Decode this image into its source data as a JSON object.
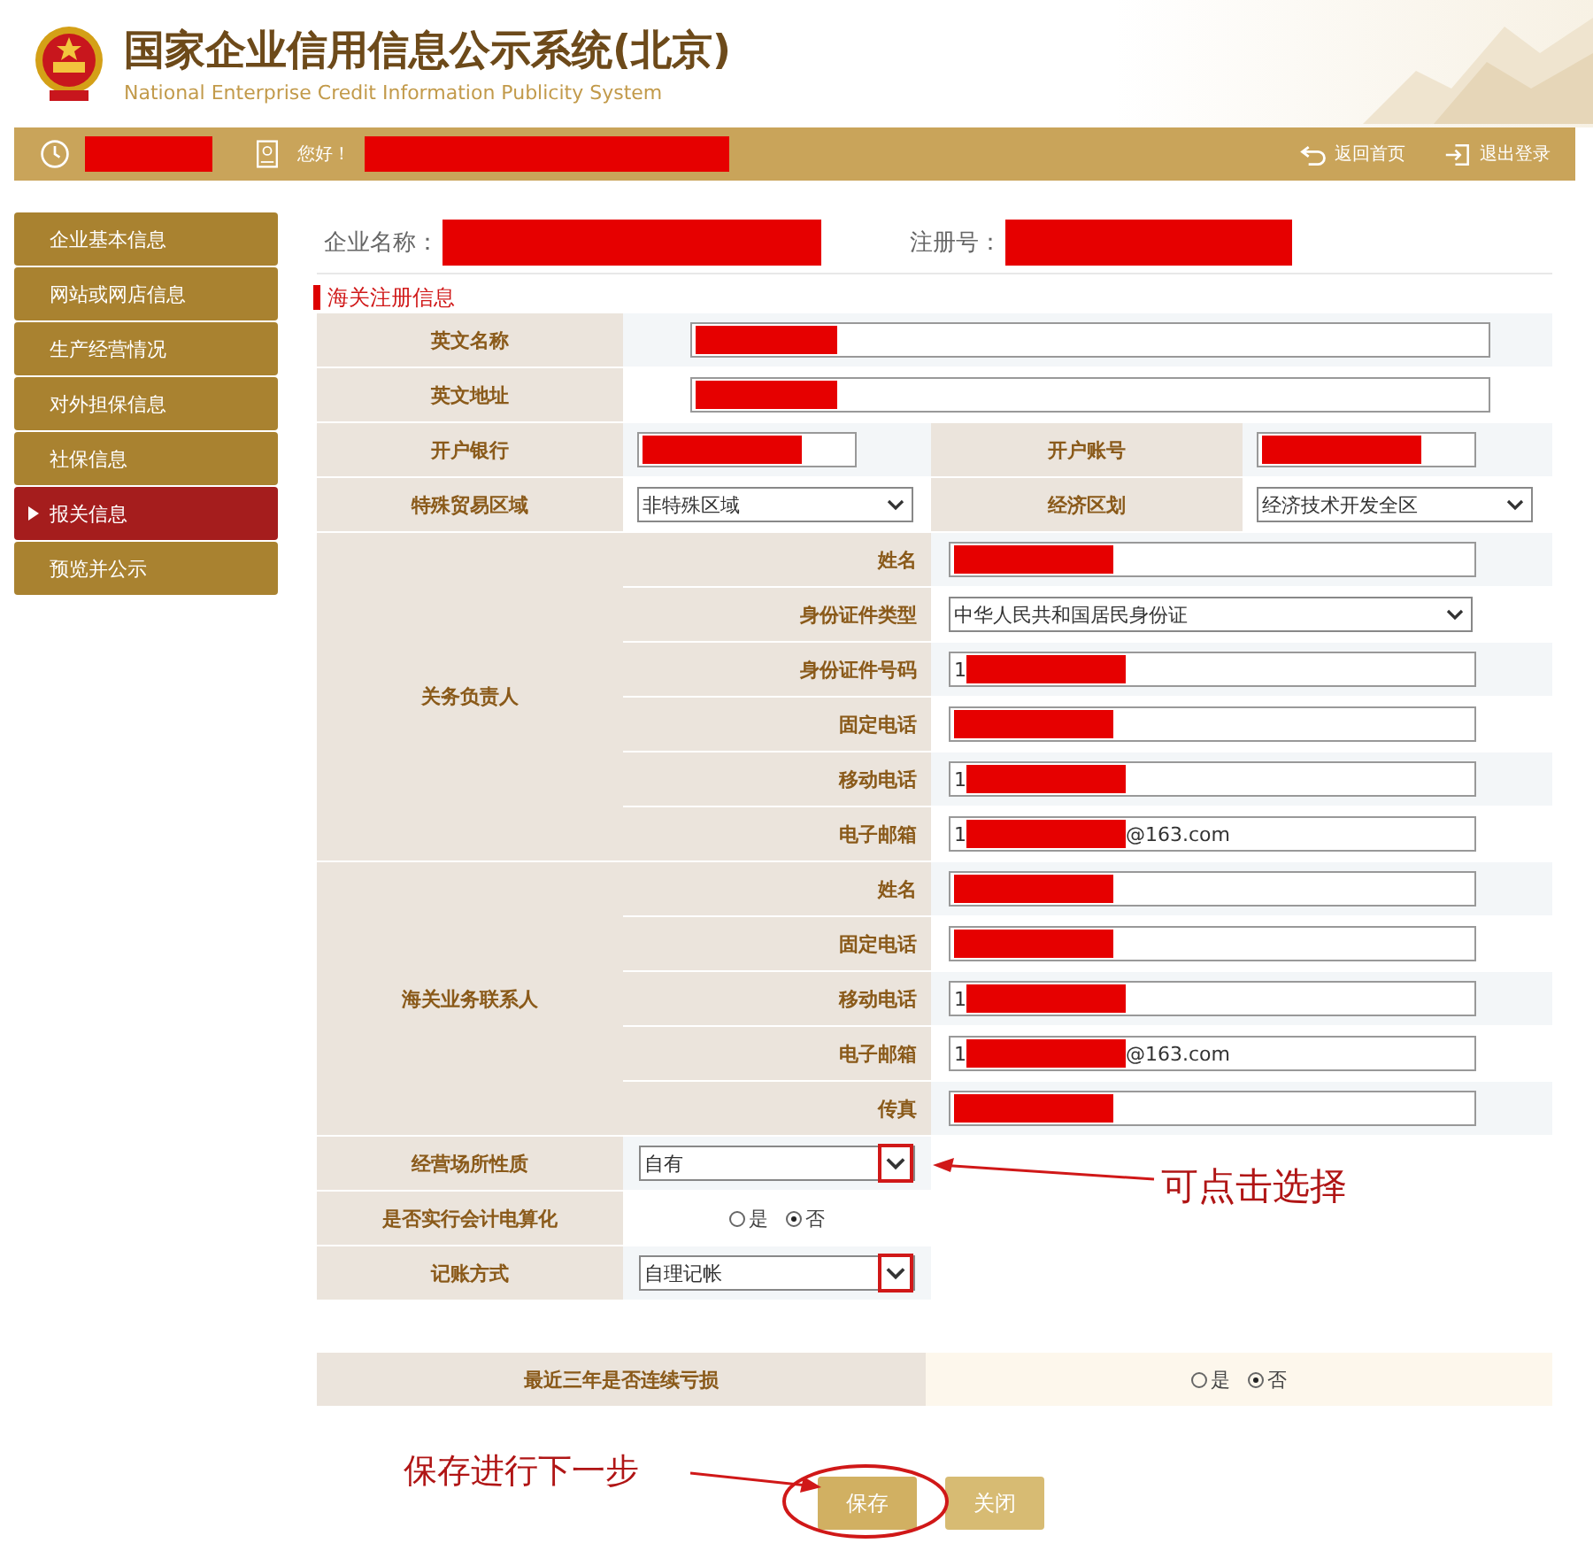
{
  "header": {
    "title": "国家企业信用信息公示系统(北京)",
    "subtitle": "National Enterprise Credit Information Publicity System"
  },
  "topbar": {
    "greeting": "您好！",
    "links": [
      {
        "label": "返回首页",
        "kind": "home"
      },
      {
        "label": "退出登录",
        "kind": "logout"
      }
    ]
  },
  "sidebar": {
    "items": [
      {
        "label": "企业基本信息",
        "selected": false
      },
      {
        "label": "网站或网店信息",
        "selected": false
      },
      {
        "label": "生产经营情况",
        "selected": false
      },
      {
        "label": "对外担保信息",
        "selected": false
      },
      {
        "label": "社保信息",
        "selected": false
      },
      {
        "label": "报关信息",
        "selected": true
      },
      {
        "label": "预览并公示",
        "selected": false
      }
    ]
  },
  "company": {
    "name_label": "企业名称：",
    "reg_label": "注册号："
  },
  "section": {
    "title": "海关注册信息"
  },
  "rows": [
    {
      "kind": "wide",
      "label": "英文名称",
      "field": {
        "kind": "text",
        "redacted": true
      }
    },
    {
      "kind": "wide",
      "label": "英文地址",
      "field": {
        "kind": "text",
        "redacted": true
      }
    },
    {
      "kind": "pair",
      "cells": [
        {
          "label": "开户银行",
          "field": {
            "kind": "text",
            "redacted": true
          }
        },
        {
          "label": "开户账号",
          "field": {
            "kind": "text",
            "redacted": true
          }
        }
      ]
    },
    {
      "kind": "pair",
      "cells": [
        {
          "label": "特殊贸易区域",
          "field": {
            "kind": "select",
            "value": "非特殊区域"
          }
        },
        {
          "label": "经济区划",
          "field": {
            "kind": "select",
            "value": "经济技术开发全区"
          }
        }
      ]
    },
    {
      "kind": "group",
      "label": "关务负责人",
      "items": [
        {
          "label": "姓名",
          "field": {
            "kind": "text",
            "redacted": true
          }
        },
        {
          "label": "身份证件类型",
          "field": {
            "kind": "select",
            "value": "中华人民共和国居民身份证"
          }
        },
        {
          "label": "身份证件号码",
          "field": {
            "kind": "text",
            "prefix": "1",
            "redacted": true
          }
        },
        {
          "label": "固定电话",
          "field": {
            "kind": "text",
            "redacted": true
          }
        },
        {
          "label": "移动电话",
          "field": {
            "kind": "text",
            "prefix": "1",
            "redacted": true
          }
        },
        {
          "label": "电子邮箱",
          "field": {
            "kind": "text",
            "prefix": "1",
            "suffix": "@163.com",
            "redacted": true
          }
        }
      ]
    },
    {
      "kind": "group",
      "label": "海关业务联系人",
      "items": [
        {
          "label": "姓名",
          "field": {
            "kind": "text",
            "redacted": true
          }
        },
        {
          "label": "固定电话",
          "field": {
            "kind": "text",
            "redacted": true
          }
        },
        {
          "label": "移动电话",
          "field": {
            "kind": "text",
            "prefix": "1",
            "redacted": true
          }
        },
        {
          "label": "电子邮箱",
          "field": {
            "kind": "text",
            "prefix": "1",
            "suffix": "@163.com",
            "redacted": true
          }
        },
        {
          "label": "传真",
          "field": {
            "kind": "text",
            "redacted": true
          }
        }
      ]
    },
    {
      "kind": "single",
      "label": "经营场所性质",
      "field": {
        "kind": "select",
        "value": "自有",
        "annotated": true
      }
    },
    {
      "kind": "single",
      "label": "是否实行会计电算化",
      "field": {
        "kind": "radio",
        "options": [
          {
            "label": "是",
            "selected": false
          },
          {
            "label": "否",
            "selected": true
          }
        ]
      }
    },
    {
      "kind": "single",
      "label": "记账方式",
      "field": {
        "kind": "select",
        "value": "自理记帐",
        "annotated": true
      }
    }
  ],
  "loss_row": {
    "label": "最近三年是否连续亏损",
    "field": {
      "kind": "radio",
      "options": [
        {
          "label": "是",
          "selected": false
        },
        {
          "label": "否",
          "selected": true
        }
      ]
    }
  },
  "buttons": [
    {
      "label": "保存",
      "kind": "primary",
      "circled": true
    },
    {
      "label": "关闭",
      "kind": "secondary"
    }
  ],
  "annotations": [
    {
      "text": "可点击选择",
      "kind": "select-hint"
    },
    {
      "text": "保存进行下一步",
      "kind": "save-hint"
    }
  ]
}
